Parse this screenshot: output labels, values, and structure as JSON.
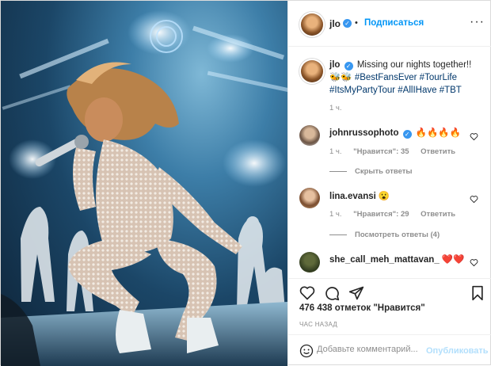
{
  "post": {
    "photo_alt": "",
    "author": {
      "username": "jlo",
      "follow_label": "Подписаться",
      "more_label": "···",
      "dot": "•"
    },
    "caption": {
      "username": "jlo",
      "line1": "Missing our nights together!!",
      "emojis": "🐝🐝",
      "tags": [
        "#BestFansEver",
        "#TourLife",
        "#ItsMyPartyTour",
        "#AllIHave",
        "#TBT"
      ],
      "time": "1 ч."
    },
    "comments": [
      {
        "username": "johnrussophoto",
        "text": "🔥🔥🔥🔥",
        "time": "1 ч.",
        "likes": "\"Нравится\": 35",
        "reply": "Ответить",
        "replies_toggle": "Скрыть ответы"
      },
      {
        "username": "lina.evansi",
        "text": "😮",
        "time": "1 ч.",
        "likes": "\"Нравится\": 29",
        "reply": "Ответить",
        "replies_toggle": "Посмотреть ответы (4)"
      },
      {
        "username": "she_call_meh_mattavan_",
        "text": "❤️❤️"
      }
    ],
    "likes_count": "476 438 отметок \"Нравится\"",
    "posted_ago": "ЧАС НАЗАД",
    "composer": {
      "emoji_icon": "smile-icon",
      "placeholder": "Добавьте комментарий...",
      "publish_label": "Опубликовать"
    },
    "colors": {
      "link": "#00376b",
      "accent": "#0095f6",
      "verified": "#3897f0",
      "muted": "#8e8e8e",
      "publish_disabled": "#b2dffc"
    }
  }
}
